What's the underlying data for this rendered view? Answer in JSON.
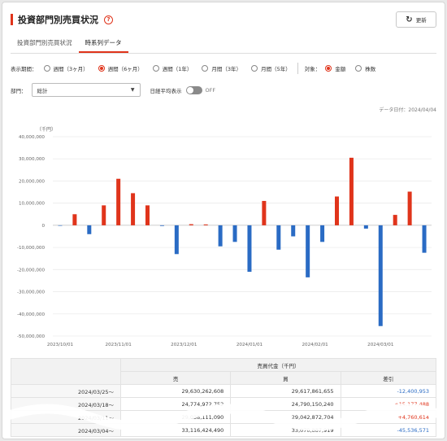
{
  "header": {
    "title": "投資部門別売買状況",
    "help_icon": "?",
    "refresh_label": "更新"
  },
  "tabs": [
    {
      "label": "投資部門別売買状況",
      "active": false
    },
    {
      "label": "時系列データ",
      "active": true
    }
  ],
  "period": {
    "label": "表示期間：",
    "options": [
      "週間（3ヶ月）",
      "週間（6ヶ月）",
      "週間（1年）",
      "月間（3年）",
      "月間（5年）"
    ],
    "selected_index": 1
  },
  "target": {
    "label": "対象：",
    "options": [
      "金額",
      "株数"
    ],
    "selected_index": 0
  },
  "sector": {
    "label": "部門：",
    "value": "総計"
  },
  "nikkei_toggle": {
    "label": "日経平均表示",
    "state": "OFF"
  },
  "as_of": "データ日付：2024/04/04",
  "colors": {
    "accent": "#e0341b",
    "positive": "#e0341b",
    "negative": "#2a6bc4"
  },
  "chart_data": {
    "type": "bar",
    "ylabel": "（千円）",
    "ylim": [
      -50000000,
      40000000
    ],
    "yticks": [
      "40,000,000",
      "30,000,000",
      "20,000,000",
      "10,000,000",
      "0",
      "-10,000,000",
      "-20,000,000",
      "-30,000,000",
      "-40,000,000",
      "-50,000,000"
    ],
    "xticks": [
      {
        "label": "2023/10/01",
        "index": 0
      },
      {
        "label": "2023/11/01",
        "index": 4
      },
      {
        "label": "2023/12/01",
        "index": 8.5
      },
      {
        "label": "2024/01/01",
        "index": 13
      },
      {
        "label": "2024/02/01",
        "index": 17.5
      },
      {
        "label": "2024/03/01",
        "index": 22
      }
    ],
    "values": [
      -200000,
      5000000,
      -4000000,
      9000000,
      21000000,
      14500000,
      9000000,
      -300000,
      -13000000,
      500000,
      400000,
      -9500000,
      -7500000,
      -21000000,
      11000000,
      -11000000,
      -5000000,
      -23500000,
      -7500000,
      13000000,
      30500000,
      -1500000,
      -45500000,
      4700000,
      15200000,
      -12400000
    ]
  },
  "table": {
    "group_header": "売買代金（千円）",
    "columns": [
      "売",
      "買",
      "差引"
    ],
    "rows": [
      {
        "date": "2024/03/25〜",
        "sell": "29,630,262,608",
        "buy": "29,617,861,655",
        "diff": "-12,400,953",
        "sign": "neg"
      },
      {
        "date": "2024/03/18〜",
        "sell": "24,774,972,752",
        "buy": "24,790,150,240",
        "diff": "+15,177,488",
        "sign": "pos"
      },
      {
        "date": "2024/03/11〜",
        "sell": "29,038,111,090",
        "buy": "29,042,872,704",
        "diff": "+4,760,614",
        "sign": "pos"
      },
      {
        "date": "2024/03/04〜",
        "sell": "33,116,424,490",
        "buy": "33,070,887,919",
        "diff": "-45,536,571",
        "sign": "neg"
      }
    ]
  }
}
